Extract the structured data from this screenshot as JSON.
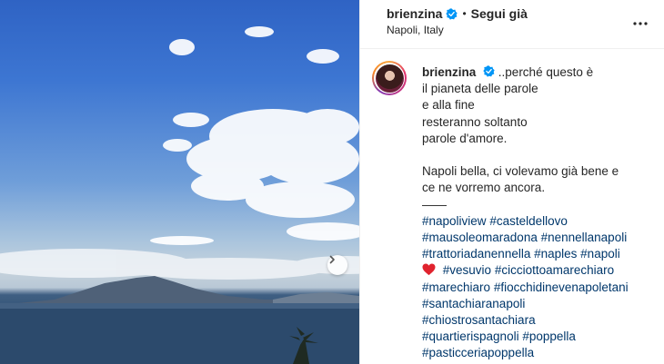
{
  "post": {
    "username": "brienzina",
    "dot": "•",
    "follow_label": "Segui già",
    "location": "Napoli, Italy"
  },
  "caption": {
    "username": "brienzina",
    "lines": [
      "..perché questo è",
      "il pianeta delle parole",
      "e alla fine",
      "resteranno soltanto",
      "parole d'amore."
    ],
    "paragraph2": [
      "Napoli bella, ci volevamo già bene e",
      "ce ne vorremo ancora."
    ],
    "separator": "——",
    "hashtag_rows": [
      [
        "#napoliview",
        "#casteldellovo"
      ],
      [
        "#mausoleomaradona",
        "#nennellanapoli"
      ],
      [
        "#trattoriadanennella",
        "#naples",
        "#napoli"
      ],
      [
        "#vesuvio",
        "#cicciottoamarechiaro"
      ],
      [
        "#marechiaro",
        "#fiocchidinevenapoletani"
      ],
      [
        "#santachiaranapoli"
      ],
      [
        "#chiostrosantachiara"
      ],
      [
        "#quartierispagnoli",
        "#poppella"
      ],
      [
        "#pasticceriapoppella"
      ]
    ]
  },
  "icons": {
    "verified": "verified-badge-icon",
    "more": "more-options-icon",
    "next": "chevron-right-icon",
    "heart": "red-heart-emoji"
  },
  "colors": {
    "hashtag": "#00376b",
    "verified": "#0095f6",
    "text": "#262626"
  }
}
